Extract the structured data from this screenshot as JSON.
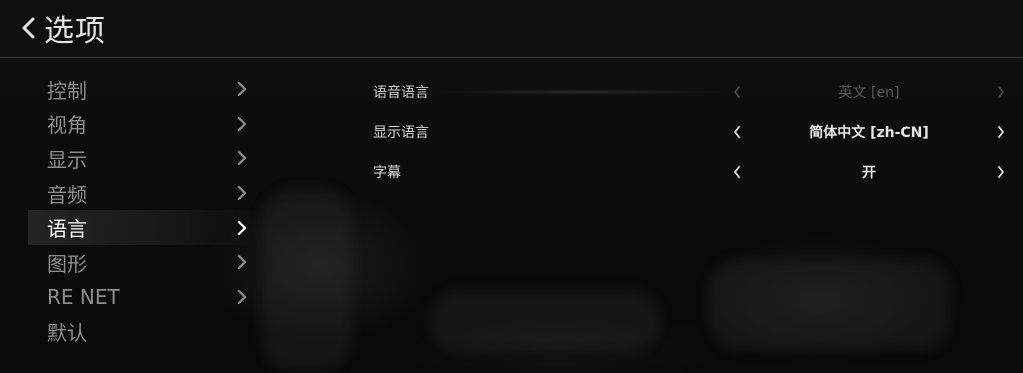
{
  "header": {
    "title": "选项",
    "back_icon": "chevron-left-icon"
  },
  "sidebar": {
    "items": [
      {
        "label": "控制",
        "active": false
      },
      {
        "label": "视角",
        "active": false
      },
      {
        "label": "显示",
        "active": false
      },
      {
        "label": "音频",
        "active": false
      },
      {
        "label": "语言",
        "active": true
      },
      {
        "label": "图形",
        "active": false
      },
      {
        "label": "RE NET",
        "active": false
      },
      {
        "label": "默认",
        "active": false
      }
    ]
  },
  "settings": {
    "rows": [
      {
        "label": "语音语言",
        "value": "英文 [en]",
        "disabled": true
      },
      {
        "label": "显示语言",
        "value": "简体中文 [zh-CN]",
        "disabled": false
      },
      {
        "label": "字幕",
        "value": "开",
        "disabled": false
      }
    ]
  },
  "colors": {
    "background": "#0b0b0b",
    "text_active": "#ffffff",
    "text_inactive": "#8e8e8e",
    "text_disabled": "#5a5a5a",
    "divider": "#3a3a3a"
  }
}
